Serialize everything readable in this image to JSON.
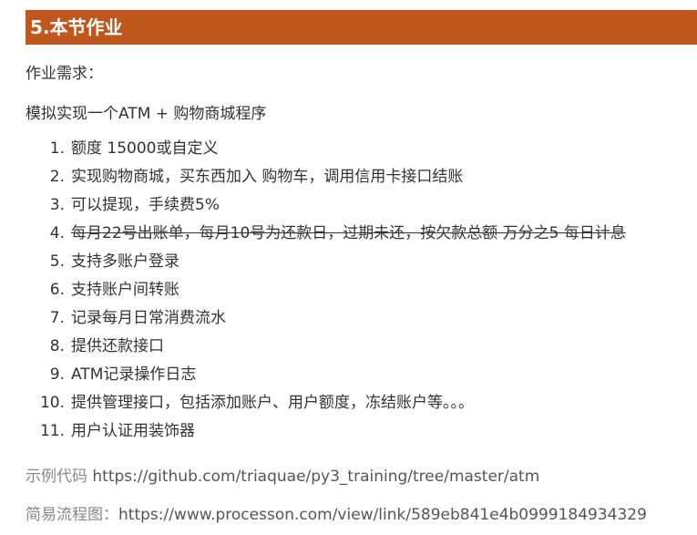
{
  "section": {
    "title": "5.本节作业"
  },
  "requirements_label": "作业需求：",
  "description": "模拟实现一个ATM + 购物商城程序",
  "items": [
    {
      "num": "1.",
      "text": "额度 15000或自定义"
    },
    {
      "num": "2.",
      "text": "实现购物商城，买东西加入 购物车，调用信用卡接口结账"
    },
    {
      "num": "3.",
      "text": "可以提现，手续费5%"
    },
    {
      "num": "4.",
      "text": "每月22号出账单，每月10号为还款日，过期未还，按欠款总额 万分之5 每日计息"
    },
    {
      "num": "5.",
      "text": "支持多账户登录"
    },
    {
      "num": "6.",
      "text": "支持账户间转账"
    },
    {
      "num": "7.",
      "text": "记录每月日常消费流水"
    },
    {
      "num": "8.",
      "text": "提供还款接口"
    },
    {
      "num": "9.",
      "text": "ATM记录操作日志"
    },
    {
      "num": "10.",
      "text": "提供管理接口，包括添加账户、用户额度，冻结账户等。。。"
    },
    {
      "num": "11.",
      "text": "用户认证用装饰器"
    }
  ],
  "code_link": {
    "label": "示例代码 ",
    "url": "https://github.com/triaquae/py3_training/tree/master/atm"
  },
  "flow_link": {
    "label": "简易流程图：",
    "url": "https://www.processon.com/view/link/589eb841e4b0999184934329"
  }
}
